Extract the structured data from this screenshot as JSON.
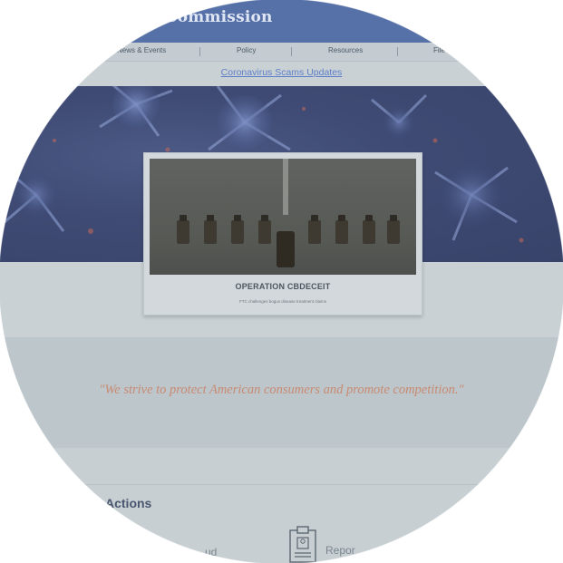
{
  "header": {
    "title": "Commission"
  },
  "nav": {
    "items": [
      {
        "label": "News & Events"
      },
      {
        "label": "Policy"
      },
      {
        "label": "Resources"
      },
      {
        "label": "File"
      }
    ]
  },
  "alert": {
    "link_text": "Coronavirus Scams Updates"
  },
  "feature": {
    "title": "OPERATION CBDECEIT",
    "subtitle": "FTC challenges bogus disease treatment claims"
  },
  "quote": {
    "text": "\"We strive to protect American consumers and promote competition.\""
  },
  "actions": {
    "title": "Actions",
    "items": [
      {
        "label": "ud"
      },
      {
        "label": "Repor"
      }
    ]
  },
  "colors": {
    "header_bg": "#5670a8",
    "link": "#5e7fc8",
    "quote": "#c98a72",
    "page_bg": "#c9d1d5"
  }
}
